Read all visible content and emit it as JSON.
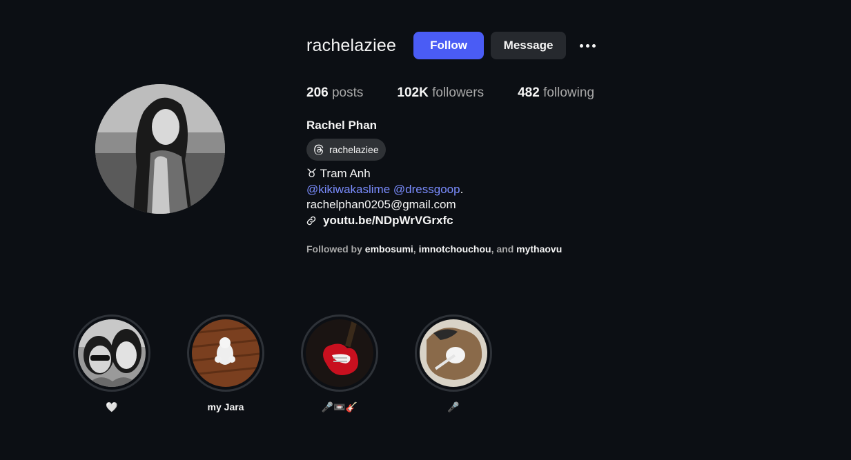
{
  "profile": {
    "username": "rachelaziee",
    "full_name": "Rachel Phan",
    "threads_handle": "rachelaziee",
    "avatar_icon": "profile-photo"
  },
  "actions": {
    "follow_label": "Follow",
    "message_label": "Message",
    "more_icon": "more-options-icon"
  },
  "stats": {
    "posts_count": "206",
    "posts_label": "posts",
    "followers_count": "102K",
    "followers_label": "followers",
    "following_count": "482",
    "following_label": "following"
  },
  "bio": {
    "line1": "♉ Tram Anh",
    "mention1": "@kikiwakaslime",
    "mention2": "@dressgoop",
    "mention_suffix": ".",
    "email": "rachelphan0205@gmail.com",
    "link": "youtu.be/NDpWrVGrxfc"
  },
  "followed_by": {
    "prefix": "Followed by",
    "name1": "embosumi",
    "name2": "imnotchouchou",
    "conj": ", and",
    "name3": "mythaovu"
  },
  "highlights": [
    {
      "label": "🤍"
    },
    {
      "label": "my Jara"
    },
    {
      "label": "🎤📼🎸"
    },
    {
      "label": "🎤"
    }
  ],
  "colors": {
    "background": "#0c0f14",
    "follow_button": "#4a5cf5",
    "message_button": "#26292e",
    "mention": "#7b8dff"
  }
}
